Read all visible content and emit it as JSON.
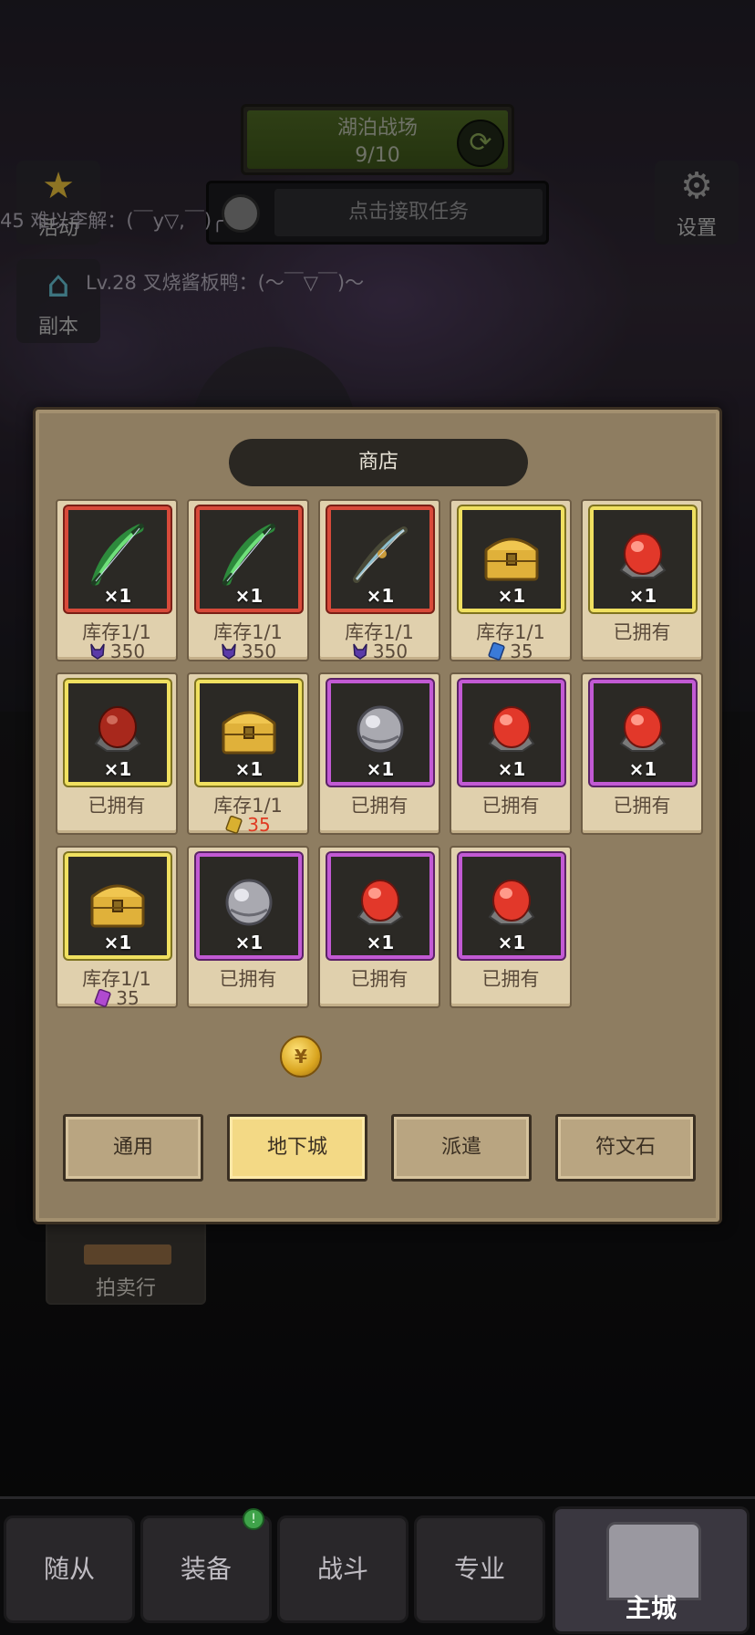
{
  "hud": {
    "banner_title": "湖泊战场",
    "banner_progress": "9/10",
    "quest_label": "点击接取任务",
    "settings_label": "设置",
    "activity_label": "活动",
    "dungeon_label": "副本",
    "chat_line_1": "45 难以李解：(￣y▽,￣)╭",
    "chat_line_2": "Lv.28 叉烧酱板鸭：(～￣▽￣)～"
  },
  "shop": {
    "title": "商店",
    "items": [
      {
        "rarity": "red",
        "icon": "green-bow-icon",
        "qty": "×1",
        "status": "库存1/1",
        "price": "350",
        "currency": "horned-demon-icon",
        "price_red": false
      },
      {
        "rarity": "red",
        "icon": "green-bow-icon",
        "qty": "×1",
        "status": "库存1/1",
        "price": "350",
        "currency": "horned-demon-icon",
        "price_red": false
      },
      {
        "rarity": "red",
        "icon": "dark-bow-icon",
        "qty": "×1",
        "status": "库存1/1",
        "price": "350",
        "currency": "horned-demon-icon",
        "price_red": false
      },
      {
        "rarity": "gold",
        "icon": "treasure-chest-icon",
        "qty": "×1",
        "status": "库存1/1",
        "price": "35",
        "currency": "blue-ticket-icon",
        "price_red": false
      },
      {
        "rarity": "gold",
        "icon": "red-gem-icon",
        "qty": "×1",
        "status": "已拥有",
        "price": "",
        "currency": "",
        "price_red": false
      },
      {
        "rarity": "gold",
        "icon": "dark-red-gem-icon",
        "qty": "×1",
        "status": "已拥有",
        "price": "",
        "currency": "",
        "price_red": false
      },
      {
        "rarity": "gold",
        "icon": "treasure-chest-icon",
        "qty": "×1",
        "status": "库存1/1",
        "price": "35",
        "currency": "gold-ticket-icon",
        "price_red": true
      },
      {
        "rarity": "purple",
        "icon": "silver-gem-icon",
        "qty": "×1",
        "status": "已拥有",
        "price": "",
        "currency": "",
        "price_red": false
      },
      {
        "rarity": "purple",
        "icon": "red-gem-icon",
        "qty": "×1",
        "status": "已拥有",
        "price": "",
        "currency": "",
        "price_red": false
      },
      {
        "rarity": "purple",
        "icon": "red-gem-icon",
        "qty": "×1",
        "status": "已拥有",
        "price": "",
        "currency": "",
        "price_red": false
      },
      {
        "rarity": "gold",
        "icon": "treasure-chest-icon",
        "qty": "×1",
        "status": "库存1/1",
        "price": "35",
        "currency": "purple-ticket-icon",
        "price_red": false
      },
      {
        "rarity": "purple",
        "icon": "silver-gem-icon",
        "qty": "×1",
        "status": "已拥有",
        "price": "",
        "currency": "",
        "price_red": false
      },
      {
        "rarity": "purple",
        "icon": "red-gem-icon",
        "qty": "×1",
        "status": "已拥有",
        "price": "",
        "currency": "",
        "price_red": false
      },
      {
        "rarity": "purple",
        "icon": "red-gem-icon",
        "qty": "×1",
        "status": "已拥有",
        "price": "",
        "currency": "",
        "price_red": false
      }
    ],
    "tabs": [
      {
        "label": "通用",
        "active": false
      },
      {
        "label": "地下城",
        "active": true
      },
      {
        "label": "派遣",
        "active": false
      },
      {
        "label": "符文石",
        "active": false
      }
    ]
  },
  "auction_label": "拍卖行",
  "nav": {
    "followers": "随从",
    "equipment": "装备",
    "battle": "战斗",
    "profession": "专业",
    "main_city": "主城",
    "equipment_badge": "!"
  },
  "colors": {
    "red_frame": "#d84a3a",
    "gold_frame": "#f0e060",
    "purple_frame": "#c25ad4",
    "active_tab": "#f3d985",
    "price_alert": "#e03a22"
  }
}
